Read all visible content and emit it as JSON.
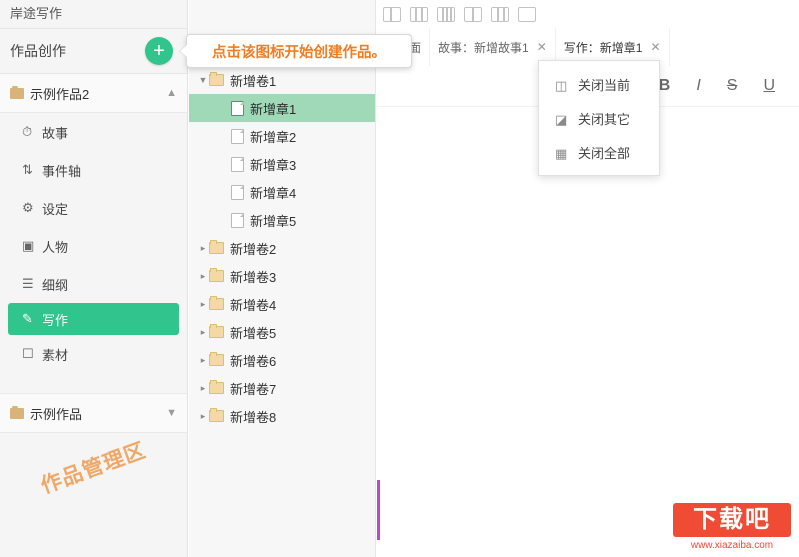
{
  "app": {
    "title": "岸途写作"
  },
  "sidebar": {
    "section_label": "作品创作",
    "add_button": "+",
    "current_work": "示例作品2",
    "nav": [
      {
        "label": "故事",
        "icon": "clock-icon"
      },
      {
        "label": "事件轴",
        "icon": "timeline-icon"
      },
      {
        "label": "设定",
        "icon": "gear-icon"
      },
      {
        "label": "人物",
        "icon": "person-card-icon"
      },
      {
        "label": "细纲",
        "icon": "list-icon"
      },
      {
        "label": "写作",
        "icon": "pencil-icon"
      },
      {
        "label": "素材",
        "icon": "material-icon"
      }
    ],
    "active_nav": "写作",
    "other_work": "示例作品",
    "watermark": "作品管理区"
  },
  "tooltip": {
    "text": "点击该图标开始创建作品。"
  },
  "tree": {
    "items": [
      {
        "label": "新增卷1",
        "type": "folder",
        "depth": 0,
        "expanded": true,
        "selected": false
      },
      {
        "label": "新增章1",
        "type": "doc",
        "depth": 1,
        "selected": true
      },
      {
        "label": "新增章2",
        "type": "doc",
        "depth": 1,
        "selected": false
      },
      {
        "label": "新增章3",
        "type": "doc",
        "depth": 1,
        "selected": false
      },
      {
        "label": "新增章4",
        "type": "doc",
        "depth": 1,
        "selected": false
      },
      {
        "label": "新增章5",
        "type": "doc",
        "depth": 1,
        "selected": false
      },
      {
        "label": "新增卷2",
        "type": "folder",
        "depth": 0,
        "expanded": false,
        "selected": false
      },
      {
        "label": "新增卷3",
        "type": "folder",
        "depth": 0,
        "expanded": false,
        "selected": false
      },
      {
        "label": "新增卷4",
        "type": "folder",
        "depth": 0,
        "expanded": false,
        "selected": false
      },
      {
        "label": "新增卷5",
        "type": "folder",
        "depth": 0,
        "expanded": false,
        "selected": false
      },
      {
        "label": "新增卷6",
        "type": "folder",
        "depth": 0,
        "expanded": false,
        "selected": false
      },
      {
        "label": "新增卷7",
        "type": "folder",
        "depth": 0,
        "expanded": false,
        "selected": false
      },
      {
        "label": "新增卷8",
        "type": "folder",
        "depth": 0,
        "expanded": false,
        "selected": false
      }
    ]
  },
  "tabs": [
    {
      "label": "的桌面",
      "closable": false,
      "active": false
    },
    {
      "label": "故事：新增故事1",
      "closable": true,
      "active": false
    },
    {
      "label": "写作：新增章1",
      "closable": true,
      "active": true
    }
  ],
  "context_menu": {
    "items": [
      {
        "label": "关闭当前",
        "icon": "close-current-icon"
      },
      {
        "label": "关闭其它",
        "icon": "close-others-icon"
      },
      {
        "label": "关闭全部",
        "icon": "close-all-icon"
      }
    ]
  },
  "format_bar": {
    "bold": "B",
    "italic": "I",
    "strikethrough": "S",
    "underline": "U"
  },
  "logo": {
    "name": "下载吧",
    "site": "www.xiazaiba.com"
  },
  "colors": {
    "accent": "#31c48d",
    "tooltip_text": "#ef7d22",
    "selection": "#9fd9b8",
    "logo": "#ef4b35"
  }
}
